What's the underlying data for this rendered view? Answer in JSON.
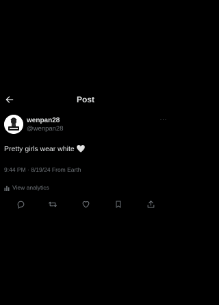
{
  "header": {
    "title": "Post",
    "back_icon": "arrow-left-icon"
  },
  "author": {
    "display_name": "wenpan28",
    "handle": "@wenpan28",
    "avatar_icon": "avatar-icon"
  },
  "more_icon": "more-horizontal-icon",
  "more_glyph": "···",
  "tweet": {
    "text": "Pretty girls wear white 🤍",
    "meta": "9:44 PM · 8/19/24 From Earth"
  },
  "analytics": {
    "label": "View analytics",
    "icon": "bar-chart-icon"
  },
  "actions": [
    {
      "name": "reply",
      "icon": "reply-icon"
    },
    {
      "name": "repost",
      "icon": "repost-icon"
    },
    {
      "name": "like",
      "icon": "heart-icon"
    },
    {
      "name": "bookmark",
      "icon": "bookmark-icon"
    },
    {
      "name": "share",
      "icon": "share-icon"
    }
  ],
  "colors": {
    "background": "#000000",
    "primary_text": "#e7e9ea",
    "secondary_text": "#71767b"
  }
}
